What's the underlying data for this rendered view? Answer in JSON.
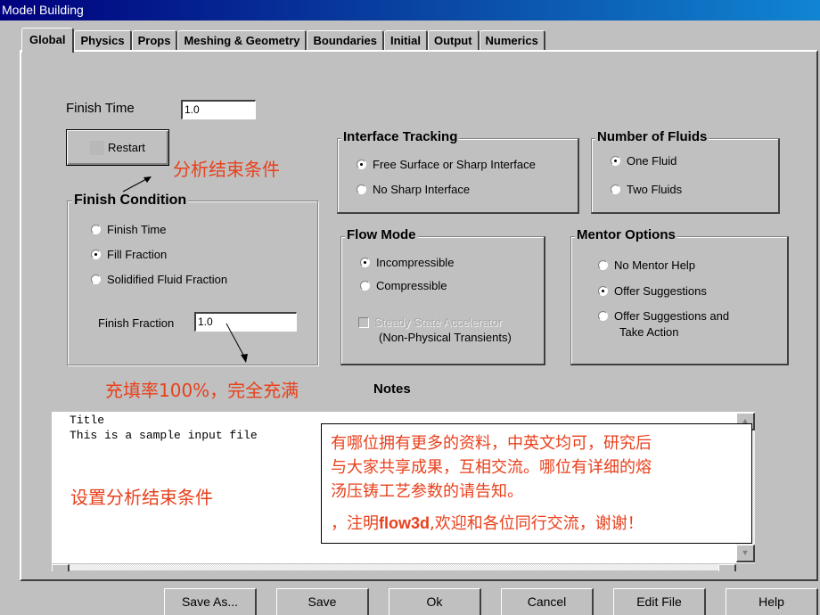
{
  "window": {
    "title": "Model Building"
  },
  "tabs": [
    {
      "label": "Global",
      "active": true
    },
    {
      "label": "Physics"
    },
    {
      "label": "Props"
    },
    {
      "label": "Meshing & Geometry"
    },
    {
      "label": "Boundaries"
    },
    {
      "label": "Initial"
    },
    {
      "label": "Output"
    },
    {
      "label": "Numerics"
    }
  ],
  "global": {
    "finish_time_label": "Finish Time",
    "finish_time_value": "1.0",
    "restart_label": "Restart",
    "finish_condition": {
      "title": "Finish Condition",
      "options": [
        {
          "label": "Finish Time",
          "selected": false
        },
        {
          "label": "Fill Fraction",
          "selected": true
        },
        {
          "label": "Solidified Fluid Fraction",
          "selected": false
        }
      ],
      "finish_fraction_label": "Finish Fraction",
      "finish_fraction_value": "1.0"
    },
    "interface_tracking": {
      "title": "Interface Tracking",
      "options": [
        {
          "label": "Free Surface or Sharp Interface",
          "selected": true
        },
        {
          "label": "No Sharp Interface",
          "selected": false
        }
      ]
    },
    "number_of_fluids": {
      "title": "Number of Fluids",
      "options": [
        {
          "label": "One Fluid",
          "selected": true
        },
        {
          "label": "Two Fluids",
          "selected": false
        }
      ]
    },
    "flow_mode": {
      "title": "Flow Mode",
      "options": [
        {
          "label": "Incompressible",
          "selected": true
        },
        {
          "label": "Compressible",
          "selected": false
        }
      ],
      "steady_state_label": "Steady State Accelerator",
      "steady_state_sublabel": "(Non-Physical Transients)",
      "steady_state_checked": false,
      "steady_state_enabled": false
    },
    "mentor_options": {
      "title": "Mentor Options",
      "options": [
        {
          "label": "No Mentor Help",
          "selected": false
        },
        {
          "label": "Offer Suggestions",
          "selected": true
        },
        {
          "label": "Offer Suggestions and",
          "label2": "Take Action",
          "selected": false
        }
      ]
    },
    "notes": {
      "label": "Notes",
      "content_line1": "Title",
      "content_line2": "This is a sample input file"
    }
  },
  "annotations": {
    "finish_condition_note": "分析结束条件",
    "fill_fraction_note": "充填率100%，完全充满",
    "notes_note": "设置分析结束条件",
    "callout_line1": "有哪位拥有更多的资料，中英文均可，研究后",
    "callout_line2": "与大家共享成果，互相交流。哪位有详细的熔",
    "callout_line3": "汤压铸工艺参数的请告知。",
    "callout_line4_prefix": "，注明",
    "callout_line4_bold": "flow3d",
    "callout_line4_suffix": ",欢迎和各位同行交流，谢谢！",
    "accent_color": "#e8401c"
  },
  "buttons": {
    "save_as": "Save As...",
    "save": "Save",
    "ok": "Ok",
    "cancel": "Cancel",
    "edit_file": "Edit File",
    "help": "Help"
  }
}
